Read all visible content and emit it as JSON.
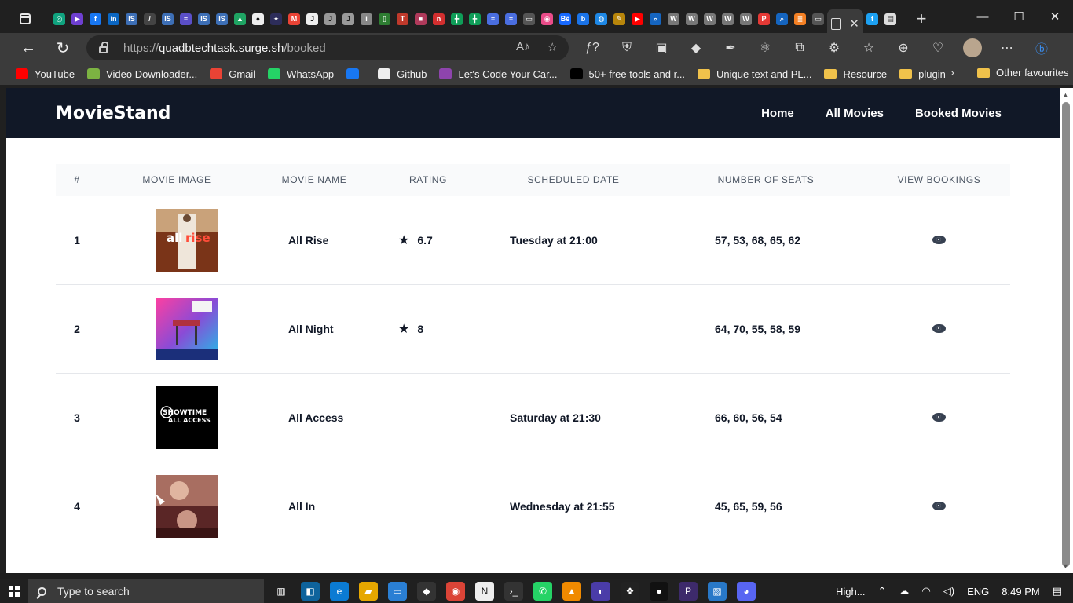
{
  "browser": {
    "url_prefix": "https://",
    "url_host": "quadbtechtask.surge.sh",
    "url_path": "/booked",
    "tab_close_glyph": "✕",
    "new_tab_glyph": "+"
  },
  "bookmarks": [
    {
      "label": "YouTube",
      "icon": "youtube-icon",
      "color": "#ff0000"
    },
    {
      "label": "Video Downloader...",
      "icon": "download-icon",
      "color": "#7cb342"
    },
    {
      "label": "Gmail",
      "icon": "gmail-icon",
      "color": "#ea4335"
    },
    {
      "label": "WhatsApp",
      "icon": "whatsapp-icon",
      "color": "#25d366"
    },
    {
      "label": "",
      "icon": "facebook-icon",
      "color": "#1877f2"
    },
    {
      "label": "Github",
      "icon": "github-icon",
      "color": "#eeeeee"
    },
    {
      "label": "Let's Code Your Car...",
      "icon": "code-icon",
      "color": "#8e44ad"
    },
    {
      "label": "50+ free tools and r...",
      "icon": "dev-icon",
      "color": "#000000"
    },
    {
      "label": "Unique text and PL...",
      "icon": "folder-icon",
      "color": "#f0c24b"
    },
    {
      "label": "Resource",
      "icon": "folder-icon",
      "color": "#f0c24b"
    },
    {
      "label": "plugin",
      "icon": "folder-icon",
      "color": "#f0c24b"
    }
  ],
  "bookmarks_other": "Other favourites",
  "site": {
    "brand": "MovieStand",
    "nav": [
      "Home",
      "All Movies",
      "Booked Movies"
    ]
  },
  "table": {
    "headers": [
      "#",
      "MOVIE IMAGE",
      "MOVIE NAME",
      "RATING",
      "SCHEDULED DATE",
      "NUMBER OF SEATS",
      "VIEW BOOKINGS"
    ],
    "rows": [
      {
        "index": "1",
        "name": "All Rise",
        "rating": "6.7",
        "date": "Tuesday at 21:00",
        "seats": "57, 53, 68, 65, 62",
        "poster_text": "all rise"
      },
      {
        "index": "2",
        "name": "All Night",
        "rating": "8",
        "date": "",
        "seats": "64, 70, 55, 58, 59",
        "poster_text": ""
      },
      {
        "index": "3",
        "name": "All Access",
        "rating": "",
        "date": "Saturday at 21:30",
        "seats": "66, 60, 56, 54",
        "poster_text": "SHOWTIME ALL ACCESS"
      },
      {
        "index": "4",
        "name": "All In",
        "rating": "",
        "date": "Wednesday at 21:55",
        "seats": "45, 65, 59, 56",
        "poster_text": ""
      }
    ]
  },
  "taskbar": {
    "search_placeholder": "Type to search",
    "weather": "High...",
    "language": "ENG",
    "time": "8:49 PM"
  },
  "colors": {
    "nav_bg": "#111827",
    "header_bg": "#f9fafb",
    "text": "#111827"
  }
}
